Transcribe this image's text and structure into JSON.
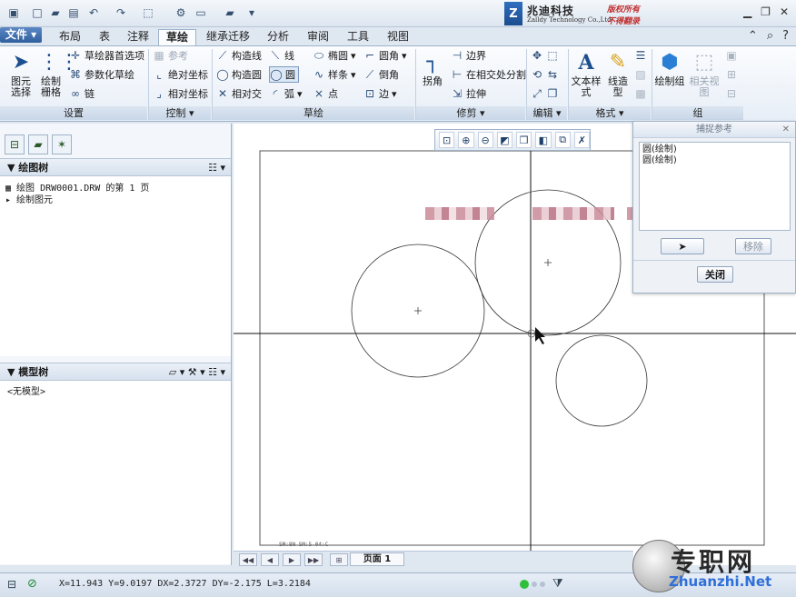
{
  "brand": {
    "logo_letter": "Z",
    "name": "兆迪科技",
    "sub": "Zalldy Technology Co.,Ltd",
    "tag1": "版权所有",
    "tag2": "不得翻录"
  },
  "tabs": {
    "file": "文件",
    "items": [
      "布局",
      "表",
      "注释",
      "草绘",
      "继承迁移",
      "分析",
      "审阅",
      "工具",
      "视图"
    ],
    "active": "草绘"
  },
  "ribbon": {
    "settings": {
      "select": "图元选择",
      "grid": "绘制栅格",
      "prefs": "草绘器首选项",
      "param": "参数化草绘",
      "chain": "链",
      "label": "设置"
    },
    "control": {
      "ref": "参考",
      "abs": "绝对坐标",
      "rel": "相对坐标",
      "label": "控制"
    },
    "sketch": {
      "cline": "构造线",
      "ccircle": "构造圆",
      "cinter": "相对交",
      "line": "线",
      "circle": "圆",
      "arc": "弧",
      "ellipse": "椭圆",
      "spline": "样条",
      "point": "点",
      "fillet": "圆角",
      "chamfer": "倒角",
      "edge": "边",
      "label": "草绘"
    },
    "trim": {
      "corner": "拐角",
      "boundary": "边界",
      "split": "在相交处分割",
      "stretch": "拉伸",
      "label": "修剪"
    },
    "edit": {
      "label": "编辑"
    },
    "format": {
      "text_style": "文本样式",
      "line_style": "线造型",
      "label": "格式"
    },
    "group": {
      "draw_group": "绘制组",
      "rel_view": "相关视图",
      "label": "组"
    }
  },
  "left": {
    "draw_tree": "绘图树",
    "draw_tree_items": [
      "绘图 DRW0001.DRW 的第 1 页",
      "绘制图元"
    ],
    "model_tree": "模型树",
    "model_tree_items": [
      "<无模型>"
    ]
  },
  "dialog": {
    "title": "捕捉参考",
    "items": [
      "圆(绘制)",
      "圆(绘制)"
    ],
    "remove": "移除",
    "close": "关闭"
  },
  "page": {
    "label": "页面 1"
  },
  "status": {
    "coords": "X=11.943 Y=9.0197 DX=2.3727 DY=-2.175 L=3.2184"
  },
  "sheet_info": "SM:8N  SM:5  04:C",
  "watermark": {
    "text": "专职网",
    "url": "Zhuanzhi.Net"
  }
}
